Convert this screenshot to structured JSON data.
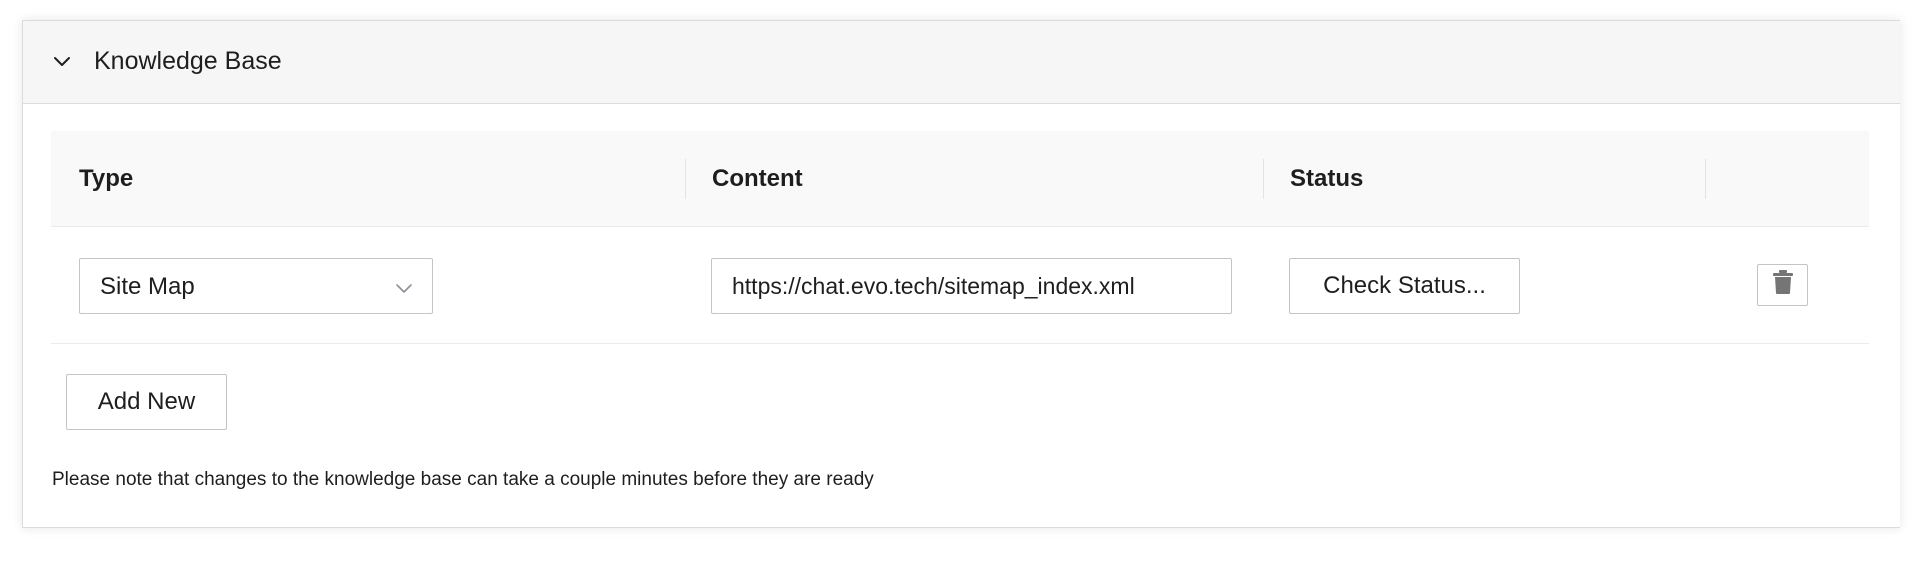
{
  "panel": {
    "title": "Knowledge Base",
    "toggle_icon": "chevron-down-icon"
  },
  "table": {
    "columns": [
      "Type",
      "Content",
      "Status",
      ""
    ],
    "rows": [
      {
        "type": "Site Map",
        "content": "https://chat.evo.tech/sitemap_index.xml",
        "status_button": "Check Status...",
        "delete_icon": "trash-icon"
      }
    ]
  },
  "actions": {
    "add_new_label": "Add New"
  },
  "note": "Please note that changes to the knowledge base can take a couple minutes before they are ready",
  "colors": {
    "header_bg": "#f6f6f6",
    "table_head_bg": "#f9f9f9",
    "border": "#c3c4c7",
    "text": "#1e1e1e",
    "icon": "#757575"
  }
}
